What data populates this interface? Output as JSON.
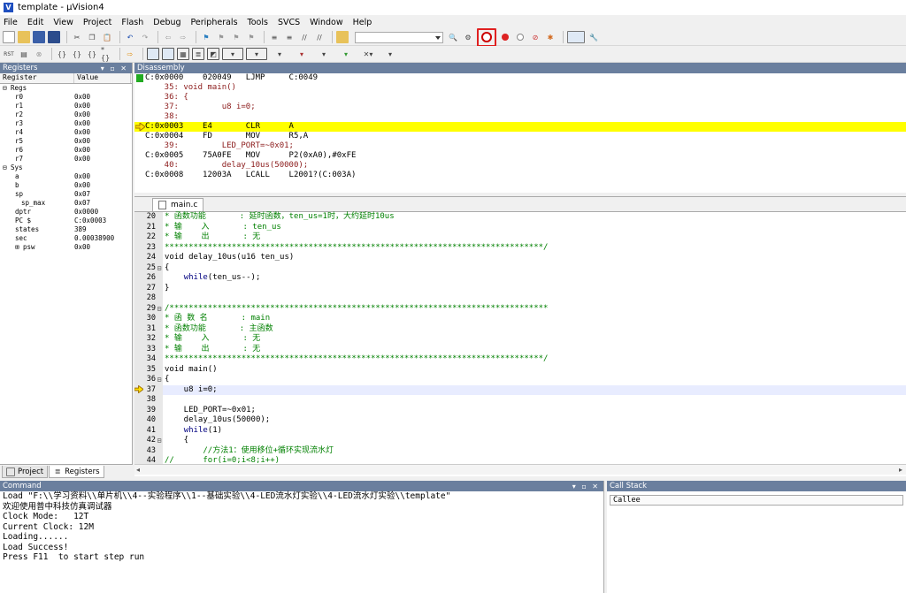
{
  "window": {
    "title": "template - µVision4"
  },
  "menu": [
    "File",
    "Edit",
    "View",
    "Project",
    "Flash",
    "Debug",
    "Peripherals",
    "Tools",
    "SVCS",
    "Window",
    "Help"
  ],
  "registers": {
    "title": "Registers",
    "col_register": "Register",
    "col_value": "Value",
    "rows": [
      {
        "name": "Regs",
        "value": "",
        "indent": 0,
        "toggle": "⊟"
      },
      {
        "name": "r0",
        "value": "0x00",
        "indent": 2,
        "toggle": ""
      },
      {
        "name": "r1",
        "value": "0x00",
        "indent": 2,
        "toggle": ""
      },
      {
        "name": "r2",
        "value": "0x00",
        "indent": 2,
        "toggle": ""
      },
      {
        "name": "r3",
        "value": "0x00",
        "indent": 2,
        "toggle": ""
      },
      {
        "name": "r4",
        "value": "0x00",
        "indent": 2,
        "toggle": ""
      },
      {
        "name": "r5",
        "value": "0x00",
        "indent": 2,
        "toggle": ""
      },
      {
        "name": "r6",
        "value": "0x00",
        "indent": 2,
        "toggle": ""
      },
      {
        "name": "r7",
        "value": "0x00",
        "indent": 2,
        "toggle": ""
      },
      {
        "name": "Sys",
        "value": "",
        "indent": 0,
        "toggle": "⊟"
      },
      {
        "name": "a",
        "value": "0x00",
        "indent": 2,
        "toggle": ""
      },
      {
        "name": "b",
        "value": "0x00",
        "indent": 2,
        "toggle": ""
      },
      {
        "name": "sp",
        "value": "0x07",
        "indent": 2,
        "toggle": ""
      },
      {
        "name": "sp_max",
        "value": "0x07",
        "indent": 3,
        "toggle": ""
      },
      {
        "name": "dptr",
        "value": "0x0000",
        "indent": 2,
        "toggle": ""
      },
      {
        "name": "PC  $",
        "value": "C:0x0003",
        "indent": 2,
        "toggle": ""
      },
      {
        "name": "states",
        "value": "389",
        "indent": 2,
        "toggle": ""
      },
      {
        "name": "sec",
        "value": "0.00038900",
        "indent": 2,
        "toggle": ""
      },
      {
        "name": "psw",
        "value": "0x00",
        "indent": 2,
        "toggle": "⊞"
      }
    ],
    "tabs": [
      "Project",
      "Registers"
    ]
  },
  "disassembly": {
    "title": "Disassembly",
    "lines": [
      {
        "text": "C:0x0000    020049   LJMP     C:0049",
        "kind": "asm",
        "mark": "green"
      },
      {
        "text": "    35: void main()",
        "kind": "src",
        "mark": ""
      },
      {
        "text": "    36: {",
        "kind": "src",
        "mark": ""
      },
      {
        "text": "    37:         u8 i=0;",
        "kind": "src",
        "mark": ""
      },
      {
        "text": "    38: ",
        "kind": "src",
        "mark": ""
      },
      {
        "text": "C:0x0003    E4       CLR      A",
        "kind": "asm",
        "mark": "arrow"
      },
      {
        "text": "C:0x0004    FD       MOV      R5,A",
        "kind": "asm",
        "mark": ""
      },
      {
        "text": "    39:         LED_PORT=~0x01;",
        "kind": "src",
        "mark": ""
      },
      {
        "text": "C:0x0005    75A0FE   MOV      P2(0xA0),#0xFE",
        "kind": "asm",
        "mark": ""
      },
      {
        "text": "    40:         delay_10us(50000);",
        "kind": "src",
        "mark": ""
      },
      {
        "text": "C:0x0008    12003A   LCALL    L2001?(C:003A)",
        "kind": "asm",
        "mark": ""
      }
    ]
  },
  "editor": {
    "tab": "main.c",
    "lines": [
      {
        "ln": "20",
        "fold": "",
        "html": "<span class='c-cm'>* 函数功能       : 延时函数，ten_us=1时，大约延时10us</span>"
      },
      {
        "ln": "21",
        "fold": "",
        "html": "<span class='c-cm'>* 输    入       : ten_us</span>"
      },
      {
        "ln": "22",
        "fold": "",
        "html": "<span class='c-cm'>* 输    出       : 无</span>"
      },
      {
        "ln": "23",
        "fold": "",
        "html": "<span class='c-cm'>*******************************************************************************/</span>"
      },
      {
        "ln": "24",
        "fold": "",
        "html": "void delay_10us(u16 ten_us)"
      },
      {
        "ln": "25",
        "fold": "⊟",
        "html": "{"
      },
      {
        "ln": "26",
        "fold": "",
        "html": "    <span class='c-kw'>while</span>(ten_us--);"
      },
      {
        "ln": "27",
        "fold": "",
        "html": "}"
      },
      {
        "ln": "28",
        "fold": "",
        "html": ""
      },
      {
        "ln": "29",
        "fold": "⊟",
        "html": "<span class='c-cm'>/*******************************************************************************</span>"
      },
      {
        "ln": "30",
        "fold": "",
        "html": "<span class='c-cm'>* 函 数 名       : main</span>"
      },
      {
        "ln": "31",
        "fold": "",
        "html": "<span class='c-cm'>* 函数功能       : 主函数</span>"
      },
      {
        "ln": "32",
        "fold": "",
        "html": "<span class='c-cm'>* 输    入       : 无</span>"
      },
      {
        "ln": "33",
        "fold": "",
        "html": "<span class='c-cm'>* 输    出       : 无</span>"
      },
      {
        "ln": "34",
        "fold": "",
        "html": "<span class='c-cm'>*******************************************************************************/</span>"
      },
      {
        "ln": "35",
        "fold": "",
        "html": "void main()"
      },
      {
        "ln": "36",
        "fold": "⊟",
        "html": "{"
      },
      {
        "ln": "37",
        "fold": "",
        "html": "    u8 i=0;",
        "cur": true
      },
      {
        "ln": "38",
        "fold": "",
        "html": ""
      },
      {
        "ln": "39",
        "fold": "",
        "html": "    LED_PORT=~0x01;"
      },
      {
        "ln": "40",
        "fold": "",
        "html": "    delay_10us(50000);"
      },
      {
        "ln": "41",
        "fold": "",
        "html": "    <span class='c-kw'>while</span>(1)"
      },
      {
        "ln": "42",
        "fold": "⊟",
        "html": "    {"
      },
      {
        "ln": "43",
        "fold": "",
        "html": "        <span class='c-cm'>//方法1：使用移位+循环实现流水灯</span>"
      },
      {
        "ln": "44",
        "fold": "",
        "html": "<span class='c-cm'>//</span>      <span class='c-cm'>for(i=0;i&lt;8;i++)</span>"
      }
    ]
  },
  "command": {
    "title": "Command",
    "lines": [
      "Load \"F:\\\\学习资料\\\\单片机\\\\4--实验程序\\\\1--基础实验\\\\4-LED流水灯实验\\\\4-LED流水灯实验\\\\template\"",
      "欢迎使用普中科技仿真调试器",
      "Clock Mode:   12T",
      "Current Clock: 12M",
      "Loading......",
      "Load Success!",
      "Press F11  to start step run"
    ]
  },
  "callstack": {
    "title": "Call Stack",
    "col": "Callee"
  },
  "colors": {
    "panel_header": "#6a7f9e",
    "highlight": "#ffff00",
    "comment": "#008000",
    "keyword": "#00007f",
    "annotation_box": "#e02020"
  }
}
